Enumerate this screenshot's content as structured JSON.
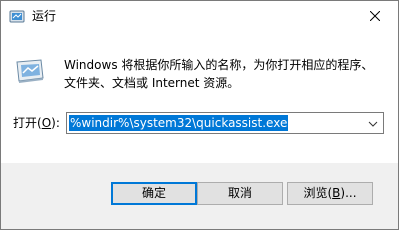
{
  "window": {
    "title": "运行",
    "icon": "run-dialog-icon",
    "close_icon": "close-icon"
  },
  "main": {
    "description": "Windows 将根据你所输入的名称，为你打开相应的程序、文件夹、文档或 Internet 资源。",
    "open_label_prefix": "打开(",
    "open_label_mnemonic": "O",
    "open_label_suffix": "):",
    "open_value": "%windir%\\system32\\quickassist.exe"
  },
  "buttons": {
    "ok": "确定",
    "cancel": "取消",
    "browse_prefix": "浏览(",
    "browse_mnemonic": "B",
    "browse_suffix": ")..."
  },
  "colors": {
    "accent": "#0078d7",
    "footer_bg": "#f0f0f0",
    "button_bg": "#e1e1e1"
  }
}
